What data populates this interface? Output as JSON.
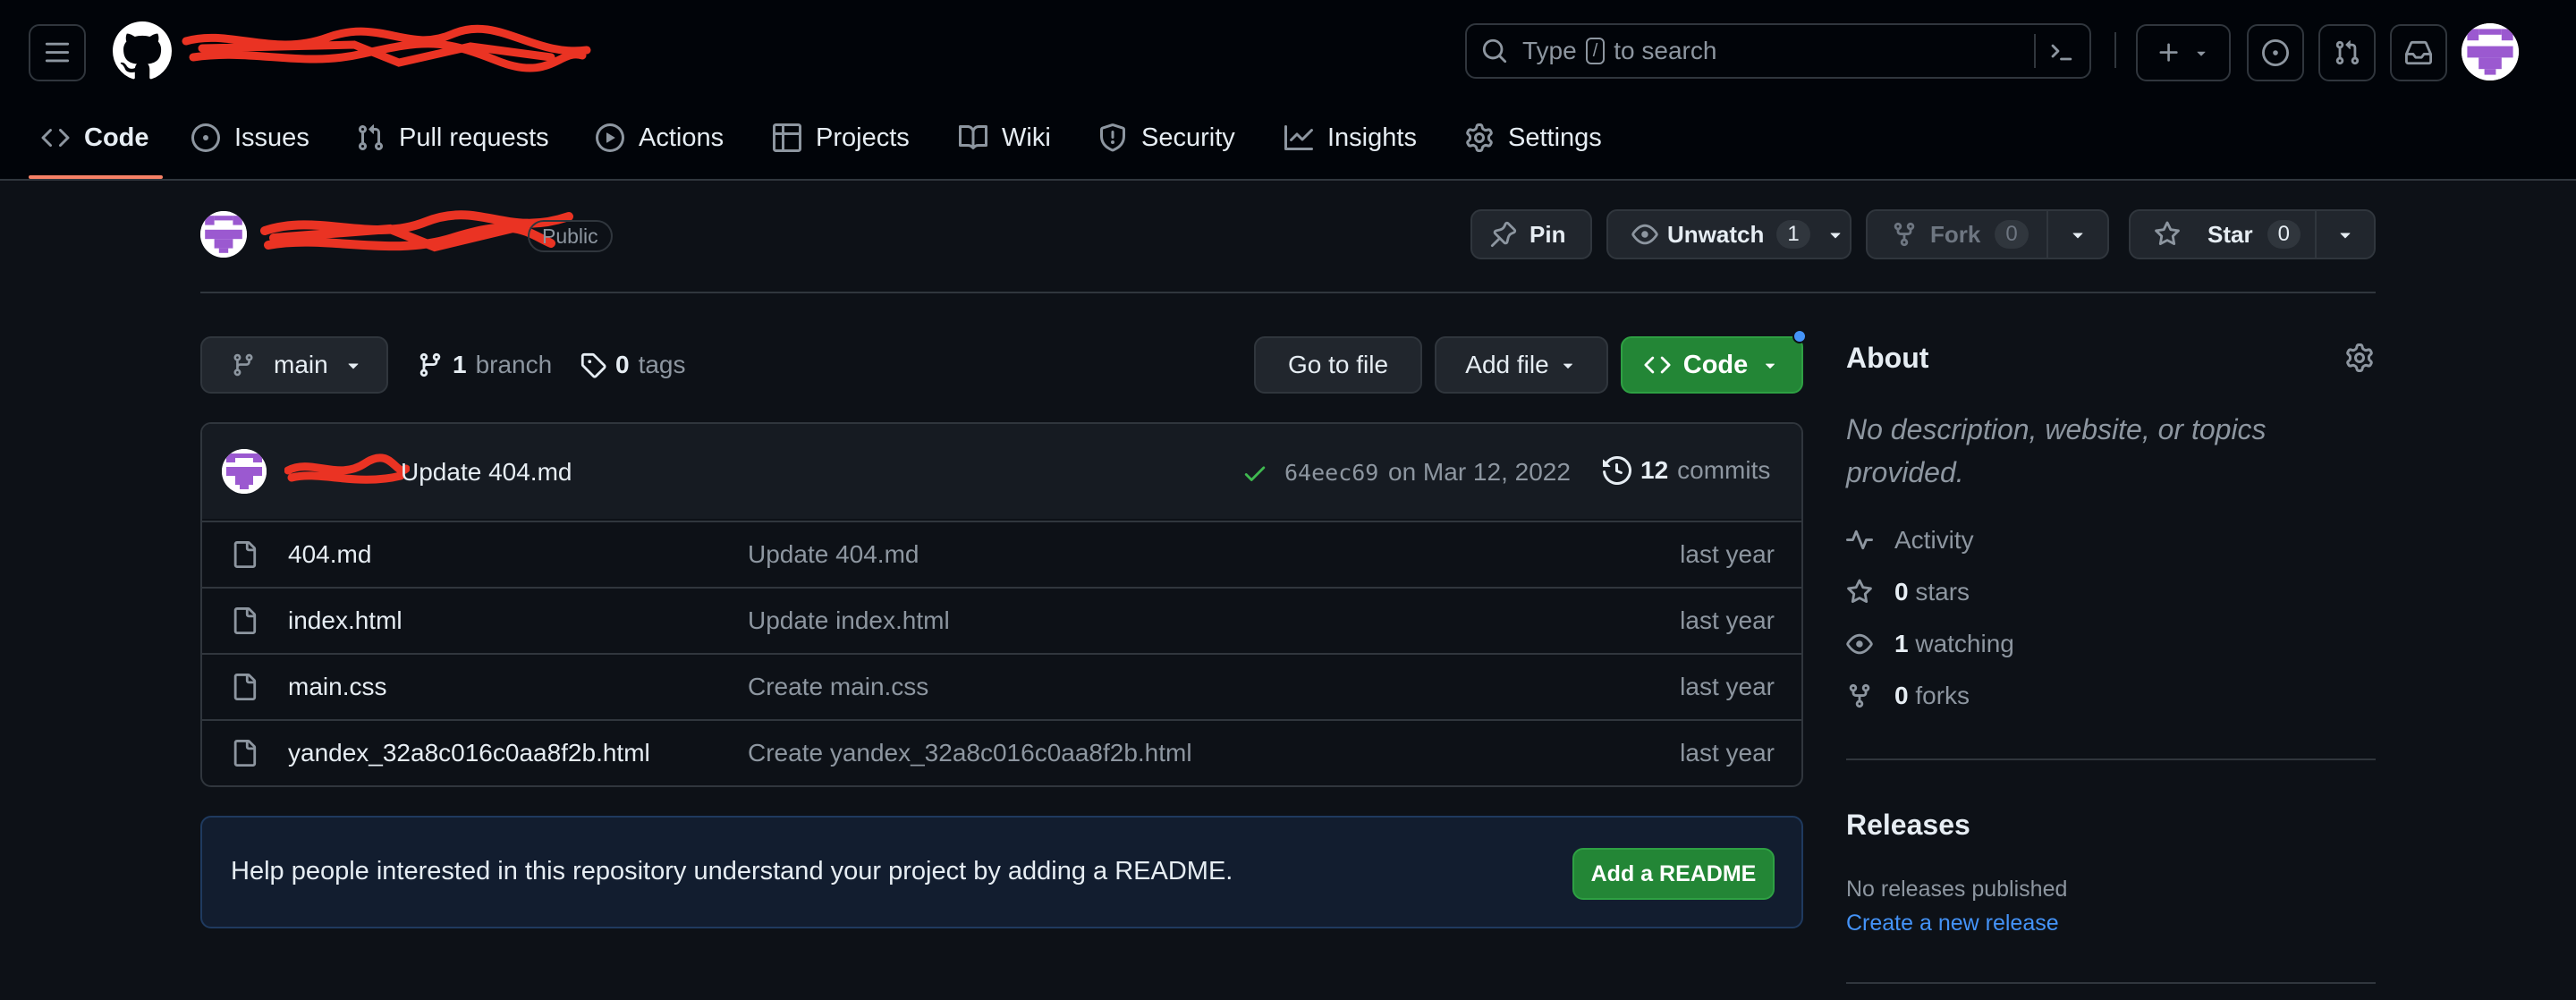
{
  "header": {
    "repo_path": "",
    "search_placeholder_prefix": "Type",
    "search_key": "/",
    "search_placeholder_suffix": "to search",
    "tabs": [
      {
        "label": "Code",
        "icon": "code-icon",
        "active": true
      },
      {
        "label": "Issues",
        "icon": "issue-icon"
      },
      {
        "label": "Pull requests",
        "icon": "pull-request-icon"
      },
      {
        "label": "Actions",
        "icon": "play-icon"
      },
      {
        "label": "Projects",
        "icon": "table-icon"
      },
      {
        "label": "Wiki",
        "icon": "book-icon"
      },
      {
        "label": "Security",
        "icon": "shield-icon"
      },
      {
        "label": "Insights",
        "icon": "graph-icon"
      },
      {
        "label": "Settings",
        "icon": "gear-icon"
      }
    ]
  },
  "repo": {
    "visibility": "Public",
    "pin_label": "Pin",
    "watch_label": "Unwatch",
    "watch_count": "1",
    "fork_label": "Fork",
    "fork_count": "0",
    "star_label": "Star",
    "star_count": "0"
  },
  "toolbar": {
    "branch": "main",
    "branch_count": "1",
    "branch_label": "branch",
    "tag_count": "0",
    "tag_label": "tags",
    "go_to_file": "Go to file",
    "add_file": "Add file",
    "code": "Code"
  },
  "commit": {
    "message": "Update 404.md",
    "sha": "64eec69",
    "date": "on Mar 12, 2022",
    "count": "12",
    "count_label": "commits"
  },
  "files": [
    {
      "name": "404.md",
      "message": "Update 404.md",
      "date": "last year"
    },
    {
      "name": "index.html",
      "message": "Update index.html",
      "date": "last year"
    },
    {
      "name": "main.css",
      "message": "Create main.css",
      "date": "last year"
    },
    {
      "name": "yandex_32a8c016c0aa8f2b.html",
      "message": "Create yandex_32a8c016c0aa8f2b.html",
      "date": "last year"
    }
  ],
  "readme": {
    "text": "Help people interested in this repository understand your project by adding a README.",
    "button": "Add a README"
  },
  "about": {
    "title": "About",
    "description": "No description, website, or topics provided.",
    "activity": "Activity",
    "stars_count": "0",
    "stars_label": "stars",
    "watching_count": "1",
    "watching_label": "watching",
    "forks_count": "0",
    "forks_label": "forks"
  },
  "releases": {
    "title": "Releases",
    "none": "No releases published",
    "create_link": "Create a new release"
  },
  "colors": {
    "background": "#0d1117",
    "header": "#010409",
    "accent_green": "#238636",
    "link_blue": "#4493f8",
    "active_tab_underline": "#f78166"
  }
}
